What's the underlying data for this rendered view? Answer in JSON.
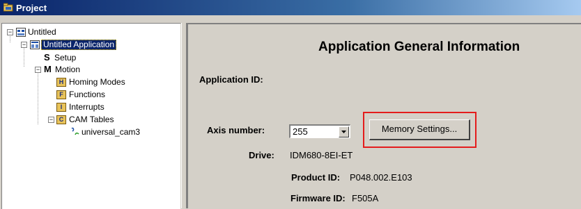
{
  "window": {
    "title": "Project",
    "icon": "project-icon"
  },
  "tree": {
    "root": {
      "label": "Untitled",
      "icon": "project-root-icon",
      "toggle": "−"
    },
    "application": {
      "label": "Untitled Application",
      "icon": "application-icon",
      "toggle": "−"
    },
    "setup": {
      "label": "Setup",
      "icon_letter": "S"
    },
    "motion": {
      "label": "Motion",
      "icon_letter": "M",
      "toggle": "−"
    },
    "homing": {
      "label": "Homing Modes",
      "icon_letter": "H"
    },
    "functions": {
      "label": "Functions",
      "icon_letter": "F"
    },
    "interrupts": {
      "label": "Interrupts",
      "icon_letter": "I"
    },
    "cam_tables": {
      "label": "CAM Tables",
      "icon_letter": "C",
      "toggle": "−"
    },
    "cam_item": {
      "label": "universal_cam3",
      "icon": "cam-curve-icon"
    }
  },
  "panel": {
    "heading": "Application General Information",
    "application_id_label": "Application ID:",
    "axis_number_label": "Axis number:",
    "axis_number_value": "255",
    "memory_settings_button": "Memory Settings...",
    "drive_label": "Drive:",
    "drive_value": "IDM680-8EI-ET",
    "product_id_label": "Product ID:",
    "product_id_value": "P048.002.E103",
    "firmware_id_label": "Firmware ID:",
    "firmware_id_value": "F505A"
  },
  "colors": {
    "highlight_box": "#e41c1c",
    "selection": "#0a246a"
  }
}
